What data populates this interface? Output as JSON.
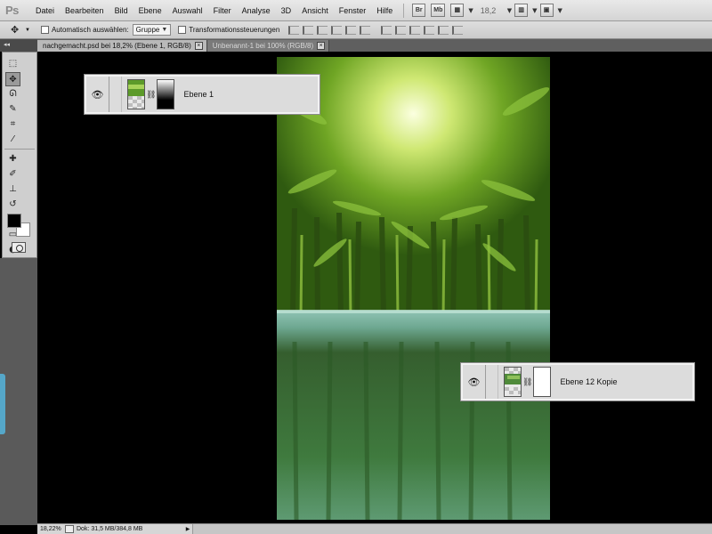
{
  "app": {
    "logo": "Ps",
    "menu": [
      "Datei",
      "Bearbeiten",
      "Bild",
      "Ebene",
      "Auswahl",
      "Filter",
      "Analyse",
      "3D",
      "Ansicht",
      "Fenster",
      "Hilfe"
    ],
    "bridge_label": "Br",
    "minibridge_label": "Mb",
    "zoom_display": "18,2"
  },
  "options": {
    "auto_select_label": "Automatisch auswählen:",
    "auto_select_value": "Gruppe",
    "transform_label": "Transformationssteuerungen"
  },
  "tabs": [
    {
      "label": "nachgemacht.psd bei 18,2% (Ebene 1, RGB/8)",
      "active": true
    },
    {
      "label": "Unbenannt-1 bei 100% (RGB/8)",
      "active": false
    }
  ],
  "layers": [
    {
      "name": "Ebene 1",
      "icon": "eye-icon"
    },
    {
      "name": "Ebene 12 Kopie",
      "icon": "eye-icon"
    }
  ],
  "status": {
    "zoom": "18,22%",
    "doc": "Dok: 31,5 MB/384,8 MB"
  },
  "colors": {
    "foreground": "#000000",
    "background": "#ffffff"
  }
}
